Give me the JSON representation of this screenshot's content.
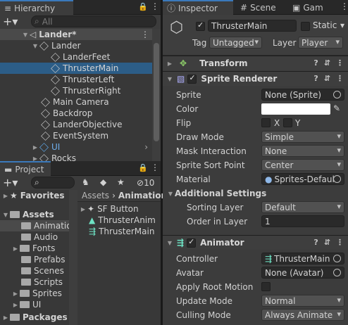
{
  "hierarchy": {
    "tab_label": "Hierarchy",
    "search_placeholder": "All",
    "scene_name": "Lander*",
    "items": [
      "Lander",
      "LanderFeet",
      "ThrusterMain",
      "ThrusterLeft",
      "ThrusterRight",
      "Main Camera",
      "Backdrop",
      "LanderObjective",
      "EventSystem",
      "UI",
      "Rocks"
    ]
  },
  "project": {
    "tab_label": "Project",
    "hidden_count": "10",
    "favorites": "Favorites",
    "assets": "Assets",
    "folders": [
      "Animatio",
      "Audio",
      "Fonts",
      "Prefabs",
      "Scenes",
      "Scripts",
      "Sprites",
      "UI"
    ],
    "packages": "Packages",
    "breadcrumb": [
      "Assets",
      "Animation"
    ],
    "files": [
      "SF Button",
      "ThrusterAnim",
      "ThrusterMain"
    ]
  },
  "inspector": {
    "tabs": [
      "Inspector",
      "Scene",
      "Gam"
    ],
    "object_name": "ThrusterMain",
    "static_label": "Static",
    "tag_label": "Tag",
    "tag_value": "Untagged",
    "layer_label": "Layer",
    "layer_value": "Player",
    "transform": "Transform",
    "sprite_renderer": {
      "title": "Sprite Renderer",
      "sprite_label": "Sprite",
      "sprite_value": "None (Sprite)",
      "color_label": "Color",
      "flip_label": "Flip",
      "flip_x": "X",
      "flip_y": "Y",
      "draw_mode_label": "Draw Mode",
      "draw_mode_value": "Simple",
      "mask_label": "Mask Interaction",
      "mask_value": "None",
      "sort_point_label": "Sprite Sort Point",
      "sort_point_value": "Center",
      "material_label": "Material",
      "material_value": "Sprites-Defaul",
      "additional": "Additional Settings",
      "sorting_layer_label": "Sorting Layer",
      "sorting_layer_value": "Default",
      "order_label": "Order in Layer",
      "order_value": "1"
    },
    "animator": {
      "title": "Animator",
      "controller_label": "Controller",
      "controller_value": "ThrusterMain",
      "avatar_label": "Avatar",
      "avatar_value": "None (Avatar)",
      "root_motion_label": "Apply Root Motion",
      "update_label": "Update Mode",
      "update_value": "Normal",
      "culling_label": "Culling Mode",
      "culling_value": "Always Animate"
    }
  },
  "colors": {
    "selection": "#2c5d87",
    "panel": "#383838",
    "accent": "#3a79bb"
  }
}
